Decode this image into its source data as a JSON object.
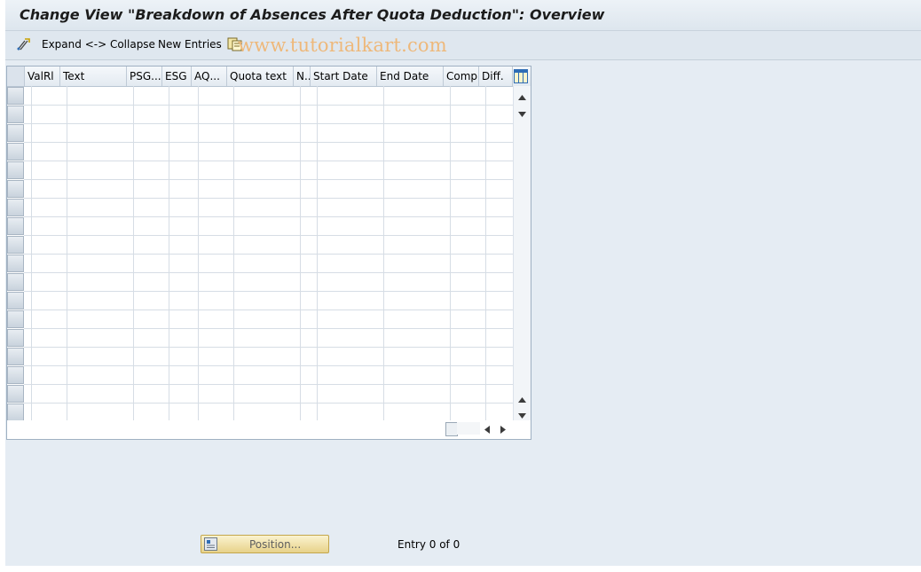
{
  "title": "Change View \"Breakdown of Absences After Quota Deduction\": Overview",
  "toolbar": {
    "items": [
      {
        "label": "Expand <-> Collapse",
        "icon": "expand-collapse-icon"
      },
      {
        "label": "New Entries",
        "icon": null
      },
      {
        "label": "",
        "icon": "copy-entries-icon"
      }
    ]
  },
  "watermark": "www.tutorialkart.com",
  "table": {
    "columns": [
      "ValRl",
      "Text",
      "PSG...",
      "ESG",
      "AQ...",
      "Quota text",
      "N..",
      "Start Date",
      "End Date",
      "Comp.",
      "Diff."
    ],
    "rows": []
  },
  "footer": {
    "position_label": "Position...",
    "entry_text": "Entry 0 of 0"
  },
  "colors": {
    "background": "#e5ecf3",
    "button": "#f1e2a8"
  }
}
